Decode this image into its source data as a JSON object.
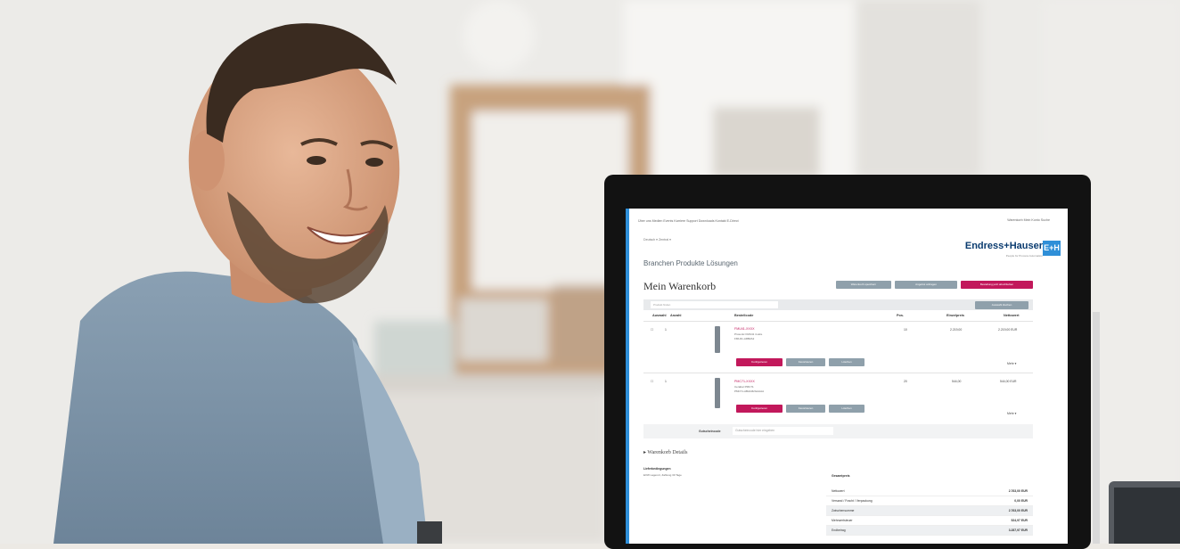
{
  "scene": {
    "description_colors": {
      "wall": "#ece9e4",
      "shirt": "#7f97ab",
      "skin": "#d9a98a",
      "hair": "#3a2b20",
      "frame": "#b8906a",
      "accent": "#c2185b",
      "brand_blue": "#2f8fd8"
    }
  },
  "screen": {
    "topbar_links": "Über uns   Medien   Events   Karriere   Support   Downloads   Kontakt   E-Direct",
    "topbar_right": "Warenkorb   Mein Konto   Suche",
    "subnav": "Deutsch ▾   Zentral ▾",
    "main_nav": "Branchen   Produkte   Lösungen",
    "logo_text": "Endress+Hauser",
    "logo_mark": "E+H",
    "logo_tagline": "People for Process Automation",
    "page_title": "Mein Warenkorb",
    "buttons": {
      "save_cart": "Warenkorb speichern",
      "request_quote": "Angebot anfragen",
      "order": "Bestellung jetzt abschließen",
      "delete_selected": "Auswahl löschen",
      "configure": "Konfigurieren",
      "favorite": "Favorisieren",
      "delete": "Löschen"
    },
    "search_placeholder": "Produkt finden",
    "headers": {
      "select": "Auswahl",
      "quantity": "Anzahl",
      "product": "Bestellcode",
      "pos": "Pos.",
      "unit_price": "Einzelpreis",
      "total": "Nettowert"
    },
    "items": [
      {
        "qty": "1",
        "code": "FMU41-XXXX",
        "name": "Prosonic FMU41 4-wire",
        "spec": "FMU41-ARB2A2",
        "pos": "10",
        "unit": "2.219,00",
        "total": "2.219,00 EUR",
        "more": "Mehr ▾"
      },
      {
        "qty": "1",
        "code": "PMC71-XXXX",
        "name": "Cerabar PMC71",
        "spec": "PMC71-ABA1M2GAAAA",
        "pos": "20",
        "unit": "544,00",
        "total": "544,00 EUR",
        "more": "Mehr ▾"
      }
    ],
    "voucher_label": "Gutscheincode",
    "voucher_placeholder": "Gutscheincode hier eingeben",
    "section_title": "▸ Warenkorb Details",
    "delivery_label": "Lieferbedingungen",
    "delivery_value": "EXW Lagerort, Zahlung 30 Tage",
    "summary_title": "Gesamtpreis",
    "summary": [
      {
        "label": "Nettowert",
        "value": "2.763,00 EUR"
      },
      {
        "label": "Versand / Fracht / Verpackung",
        "value": "0,00 EUR"
      },
      {
        "label": "Zwischensumme",
        "value": "2.763,00 EUR"
      },
      {
        "label": "Mehrwertsteuer",
        "value": "524,97 EUR"
      },
      {
        "label": "Endbetrag",
        "value": "3.287,97 EUR"
      }
    ]
  }
}
